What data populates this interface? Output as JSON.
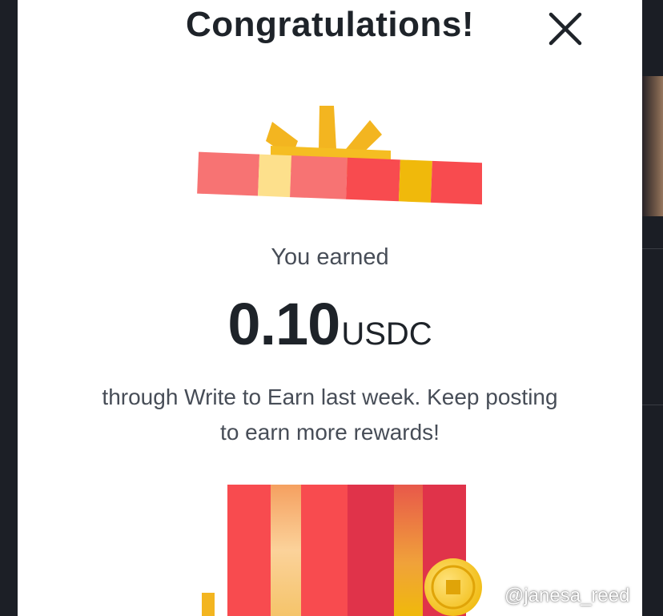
{
  "modal": {
    "title": "Congratulations!",
    "close_icon": "close-icon",
    "earned_label": "You earned",
    "amount": "0.10",
    "currency": "USDC",
    "message": "through Write to Earn last week. Keep posting to earn more rewards!"
  },
  "illustration": {
    "lid_icon": "gift-lid-icon",
    "box_icon": "gift-box-icon",
    "coin_icon": "coin-icon"
  },
  "watermark": {
    "text": "@janesa_reed",
    "icon": "binance-logo-icon"
  },
  "colors": {
    "modal_bg": "#ffffff",
    "page_bg": "#1f2128",
    "title_text": "#1e2329",
    "body_text": "#474d57",
    "gift_red": "#f84b4f",
    "gift_pink": "#f77373",
    "gift_yellow": "#f0b90b"
  }
}
